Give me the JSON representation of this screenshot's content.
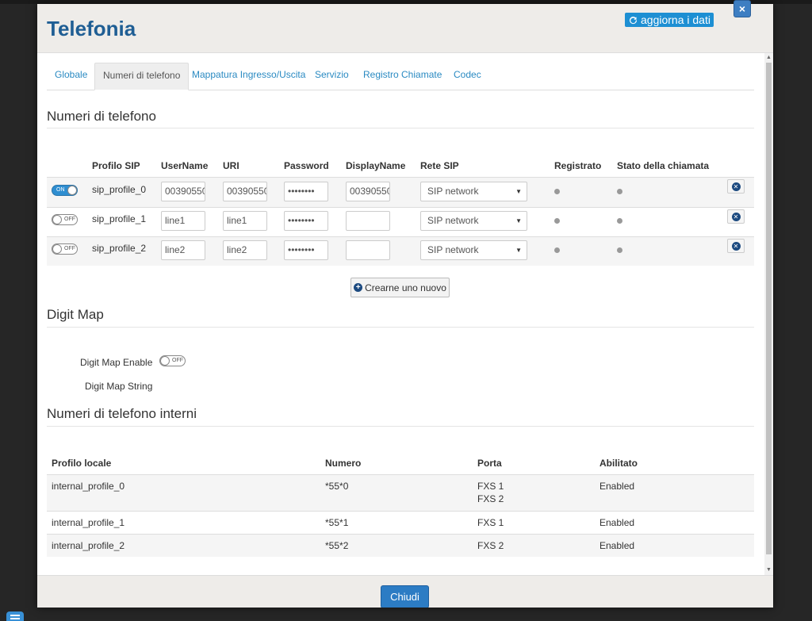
{
  "modal": {
    "title": "Telefonia",
    "refresh_label": "aggiorna i dati",
    "close_symbol": "×",
    "footer_close_label": "Chiudi"
  },
  "tabs": [
    {
      "label": "Globale",
      "active": false
    },
    {
      "label": "Numeri di telefono",
      "active": true
    },
    {
      "label": "Mappatura Ingresso/Uscita",
      "active": false
    },
    {
      "label": "Servizio",
      "active": false
    },
    {
      "label": "Registro Chiamate",
      "active": false
    },
    {
      "label": "Codec",
      "active": false
    }
  ],
  "phone_numbers": {
    "section_title": "Numeri di telefono",
    "headers": {
      "profile": "Profilo SIP",
      "username": "UserName",
      "uri": "URI",
      "password": "Password",
      "display_name": "DisplayName",
      "network": "Rete SIP",
      "registered": "Registrato",
      "call_state": "Stato della chiamata"
    },
    "rows": [
      {
        "enabled": "ON",
        "profile": "sip_profile_0",
        "username": "00390550",
        "uri": "00390550",
        "password": "••••••••",
        "display_name": "00390550",
        "network": "SIP network"
      },
      {
        "enabled": "OFF",
        "profile": "sip_profile_1",
        "username": "line1",
        "uri": "line1",
        "password": "••••••••",
        "display_name": "",
        "network": "SIP network"
      },
      {
        "enabled": "OFF",
        "profile": "sip_profile_2",
        "username": "line2",
        "uri": "line2",
        "password": "••••••••",
        "display_name": "",
        "network": "SIP network"
      }
    ],
    "create_label": "Crearne uno nuovo"
  },
  "digit_map": {
    "section_title": "Digit Map",
    "enable_label": "Digit Map Enable",
    "enable_state": "OFF",
    "string_label": "Digit Map String"
  },
  "internal_numbers": {
    "section_title": "Numeri di telefono interni",
    "headers": {
      "profile": "Profilo locale",
      "number": "Numero",
      "port": "Porta",
      "enabled": "Abilitato"
    },
    "rows": [
      {
        "profile": "internal_profile_0",
        "number": "*55*0",
        "port_1": "FXS 1",
        "port_2": "FXS 2",
        "enabled": "Enabled"
      },
      {
        "profile": "internal_profile_1",
        "number": "*55*1",
        "port_1": "FXS 1",
        "port_2": "",
        "enabled": "Enabled"
      },
      {
        "profile": "internal_profile_2",
        "number": "*55*2",
        "port_1": "FXS 2",
        "port_2": "",
        "enabled": "Enabled"
      }
    ]
  },
  "colors": {
    "accent": "#2c7cc4",
    "title": "#1f5e94",
    "link": "#2a8ac2"
  }
}
